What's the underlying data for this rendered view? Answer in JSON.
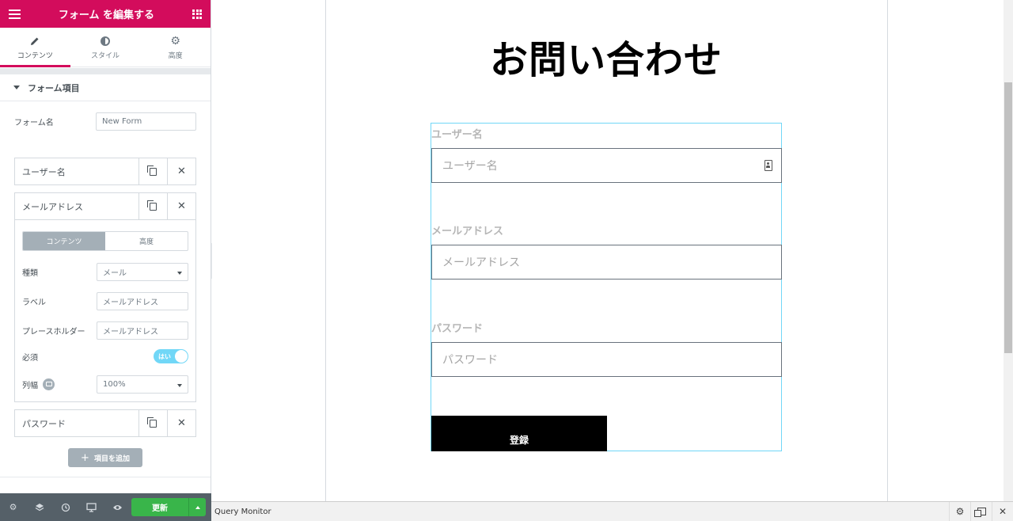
{
  "panel": {
    "header_title": "フォーム を編集する",
    "tabs": [
      {
        "label": "コンテンツ",
        "icon": "pencil-icon"
      },
      {
        "label": "スタイル",
        "icon": "contrast-icon"
      },
      {
        "label": "高度",
        "icon": "gear-icon"
      }
    ],
    "section_title": "フォーム項目",
    "form_name": {
      "label": "フォーム名",
      "value": "New Form"
    },
    "fields": [
      {
        "title": "ユーザー名"
      },
      {
        "title": "メールアドレス"
      },
      {
        "title": "パスワード"
      }
    ],
    "field_editor": {
      "tabs": [
        "コンテンツ",
        "高度"
      ],
      "type": {
        "label": "種類",
        "value": "メール"
      },
      "label": {
        "label": "ラベル",
        "value": "メールアドレス"
      },
      "placeholder": {
        "label": "プレースホルダー",
        "value": "メールアドレス"
      },
      "required": {
        "label": "必須",
        "value": "はい"
      },
      "column_width": {
        "label": "列幅",
        "value": "100%"
      }
    },
    "add_item_label": "項目を追加",
    "footer": {
      "update_label": "更新"
    }
  },
  "preview": {
    "title": "お問い合わせ",
    "form": {
      "fields": [
        {
          "label": "ユーザー名",
          "placeholder": "ユーザー名"
        },
        {
          "label": "メールアドレス",
          "placeholder": "メールアドレス"
        },
        {
          "label": "パスワード",
          "placeholder": "パスワード"
        }
      ],
      "submit_label": "登録"
    }
  },
  "query_monitor": {
    "title": "Query Monitor"
  },
  "colors": {
    "brand": "#d30c5c",
    "update": "#39b54a",
    "toggle": "#71d7f7"
  }
}
